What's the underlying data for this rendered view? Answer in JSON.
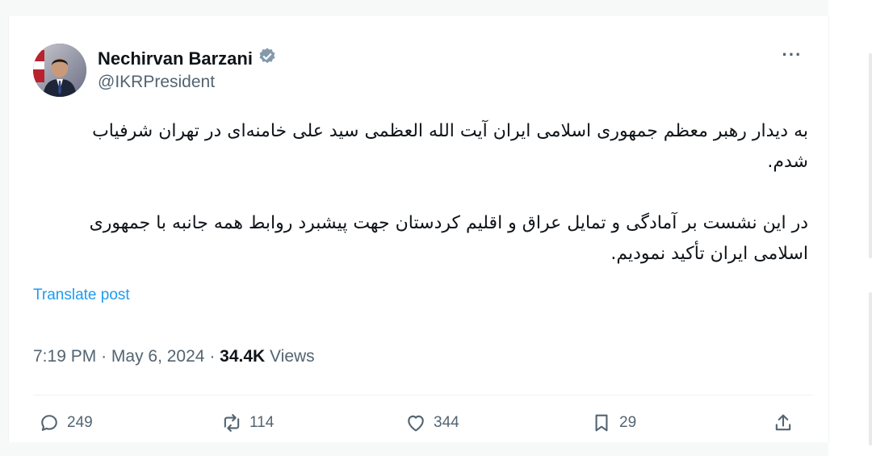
{
  "author": {
    "name": "Nechirvan Barzani",
    "handle": "@IKRPresident"
  },
  "post": {
    "paragraph1": "به دیدار رهبر معظم جمهوری اسلامی ایران آیت الله العظمی سید علی خامنه‌ای در تهران شرفیاب شدم.",
    "paragraph2": "در این نشست  بر آمادگی و تمایل عراق و اقلیم کردستان جهت پیشبرد روابط همه جانبه با جمهوری اسلامی ایران تأکید نمودیم.",
    "translate_label": "Translate post",
    "time": "7:19 PM",
    "date": "May 6, 2024",
    "views_count": "34.4K",
    "views_label": "Views"
  },
  "actions": {
    "replies": "249",
    "reposts": "114",
    "likes": "344",
    "bookmarks": "29"
  },
  "colors": {
    "text": "#0f1419",
    "secondary": "#536471",
    "link": "#1d9bf0",
    "verified_badge": "#829aab"
  }
}
